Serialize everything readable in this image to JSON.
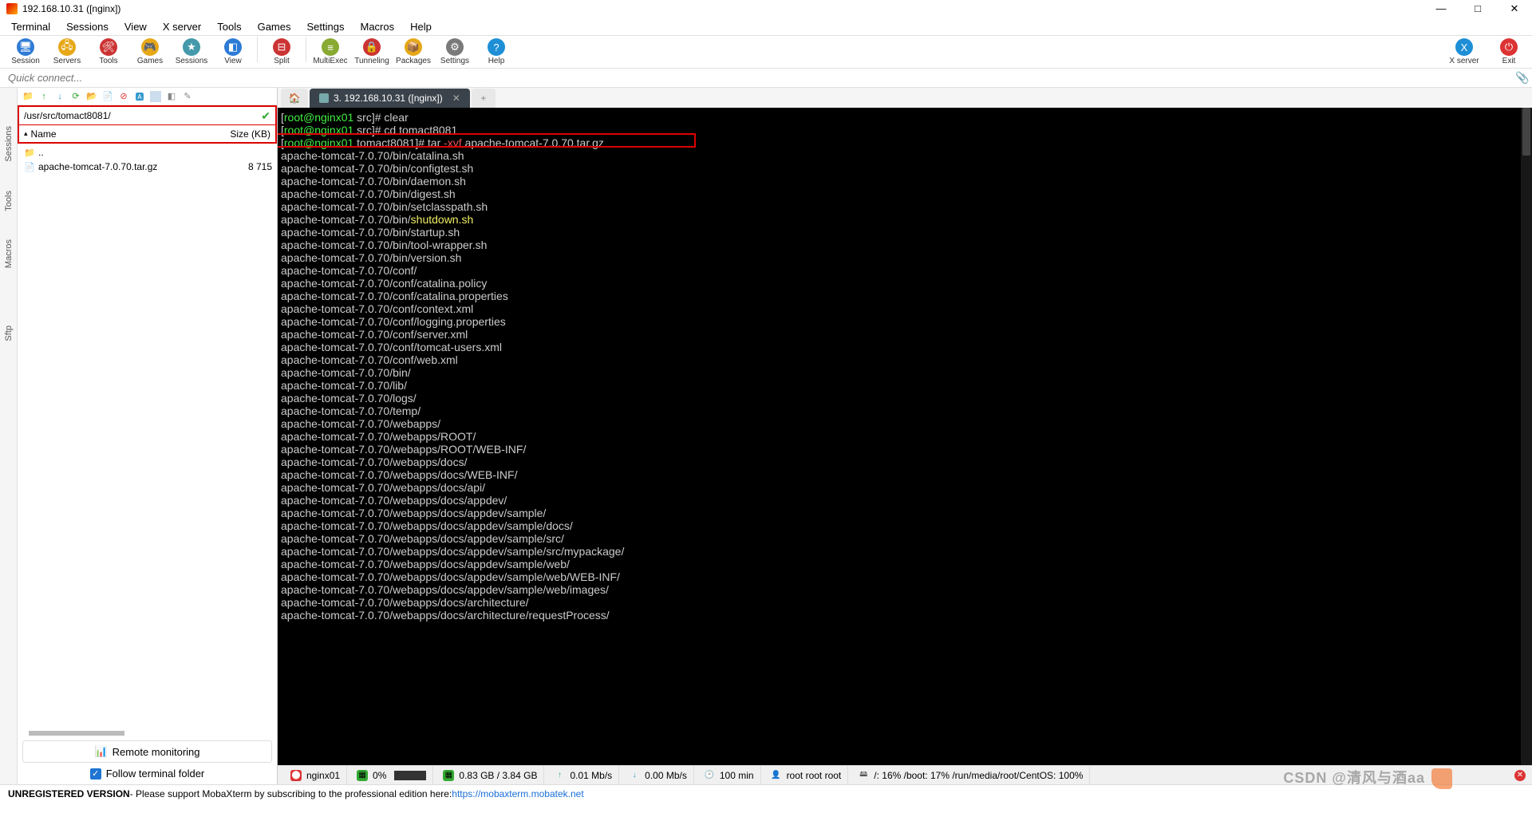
{
  "window": {
    "title": "192.168.10.31 ([nginx])"
  },
  "menu": [
    "Terminal",
    "Sessions",
    "View",
    "X server",
    "Tools",
    "Games",
    "Settings",
    "Macros",
    "Help"
  ],
  "toolbar": [
    {
      "label": "Session",
      "color": "#2e7bd6",
      "glyph": "🖥"
    },
    {
      "label": "Servers",
      "color": "#e6a817",
      "glyph": "🖧"
    },
    {
      "label": "Tools",
      "color": "#c33",
      "glyph": "🛠"
    },
    {
      "label": "Games",
      "color": "#e6a817",
      "glyph": "🎮"
    },
    {
      "label": "Sessions",
      "color": "#49a",
      "glyph": "★"
    },
    {
      "label": "View",
      "color": "#2e7bd6",
      "glyph": "◧"
    },
    {
      "label": "Split",
      "color": "#c33",
      "glyph": "⊟"
    },
    {
      "label": "MultiExec",
      "color": "#8a3",
      "glyph": "≡"
    },
    {
      "label": "Tunneling",
      "color": "#c33",
      "glyph": "🔒"
    },
    {
      "label": "Packages",
      "color": "#e6a817",
      "glyph": "📦"
    },
    {
      "label": "Settings",
      "color": "#7a7a7a",
      "glyph": "⚙"
    },
    {
      "label": "Help",
      "color": "#1e8fd6",
      "glyph": "?"
    }
  ],
  "toolbar_right": [
    {
      "label": "X server",
      "color": "#1e8fd6",
      "glyph": "X"
    },
    {
      "label": "Exit",
      "color": "#d33",
      "glyph": "⏻"
    }
  ],
  "quick_placeholder": "Quick connect...",
  "sidetabs": [
    "Sessions",
    "Tools",
    "Macros",
    "Sftp"
  ],
  "sftp": {
    "path": "/usr/src/tomact8081/",
    "cols": {
      "name": "Name",
      "size": "Size (KB)"
    },
    "rows": [
      {
        "icon": "📁",
        "name": "..",
        "size": ""
      },
      {
        "icon": "📄",
        "name": "apache-tomcat-7.0.70.tar.gz",
        "size": "8 715"
      }
    ],
    "monitor_btn": "Remote monitoring",
    "follow_chk": "Follow terminal folder"
  },
  "tabs": {
    "active_label": "3. 192.168.10.31 ([nginx])"
  },
  "terminal": {
    "prompt_user": "root",
    "prompt_host": "nginx01",
    "prompt_dir1": "src",
    "prompt_dir2": "tomact8081",
    "cmd1": "clear",
    "cmd2": "cd tomact8081",
    "cmd3_pre": "tar ",
    "cmd3_opt": "-xvf",
    "cmd3_arg": " apache-tomcat-7.0.70.tar.gz",
    "lines": [
      "apache-tomcat-7.0.70/bin/catalina.sh",
      "apache-tomcat-7.0.70/bin/configtest.sh",
      "apache-tomcat-7.0.70/bin/daemon.sh",
      "apache-tomcat-7.0.70/bin/digest.sh",
      "apache-tomcat-7.0.70/bin/setclasspath.sh",
      "apache-tomcat-7.0.70/bin/shutdown.sh",
      "apache-tomcat-7.0.70/bin/startup.sh",
      "apache-tomcat-7.0.70/bin/tool-wrapper.sh",
      "apache-tomcat-7.0.70/bin/version.sh",
      "apache-tomcat-7.0.70/conf/",
      "apache-tomcat-7.0.70/conf/catalina.policy",
      "apache-tomcat-7.0.70/conf/catalina.properties",
      "apache-tomcat-7.0.70/conf/context.xml",
      "apache-tomcat-7.0.70/conf/logging.properties",
      "apache-tomcat-7.0.70/conf/server.xml",
      "apache-tomcat-7.0.70/conf/tomcat-users.xml",
      "apache-tomcat-7.0.70/conf/web.xml",
      "apache-tomcat-7.0.70/bin/",
      "apache-tomcat-7.0.70/lib/",
      "apache-tomcat-7.0.70/logs/",
      "apache-tomcat-7.0.70/temp/",
      "apache-tomcat-7.0.70/webapps/",
      "apache-tomcat-7.0.70/webapps/ROOT/",
      "apache-tomcat-7.0.70/webapps/ROOT/WEB-INF/",
      "apache-tomcat-7.0.70/webapps/docs/",
      "apache-tomcat-7.0.70/webapps/docs/WEB-INF/",
      "apache-tomcat-7.0.70/webapps/docs/api/",
      "apache-tomcat-7.0.70/webapps/docs/appdev/",
      "apache-tomcat-7.0.70/webapps/docs/appdev/sample/",
      "apache-tomcat-7.0.70/webapps/docs/appdev/sample/docs/",
      "apache-tomcat-7.0.70/webapps/docs/appdev/sample/src/",
      "apache-tomcat-7.0.70/webapps/docs/appdev/sample/src/mypackage/",
      "apache-tomcat-7.0.70/webapps/docs/appdev/sample/web/",
      "apache-tomcat-7.0.70/webapps/docs/appdev/sample/web/WEB-INF/",
      "apache-tomcat-7.0.70/webapps/docs/appdev/sample/web/images/",
      "apache-tomcat-7.0.70/webapps/docs/architecture/",
      "apache-tomcat-7.0.70/webapps/docs/architecture/requestProcess/"
    ]
  },
  "status": {
    "host": "nginx01",
    "cpu": "0%",
    "mem": "0.83 GB / 3.84 GB",
    "up": "0.01 Mb/s",
    "down": "0.00 Mb/s",
    "uptime": "100 min",
    "user": "root  root  root",
    "disks": "/: 16%   /boot: 17%   /run/media/root/CentOS: 100%"
  },
  "footer": {
    "bold": "UNREGISTERED VERSION",
    "text": " -  Please support MobaXterm by subscribing to the professional edition here:  ",
    "link": "https://mobaxterm.mobatek.net"
  },
  "watermark": "CSDN @清风与酒aa"
}
